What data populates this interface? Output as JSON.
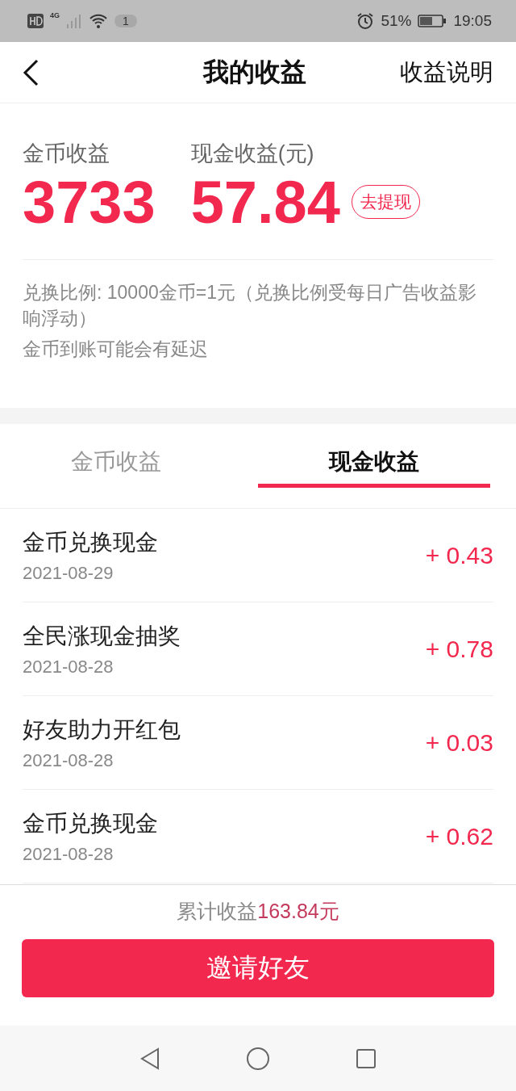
{
  "status_bar": {
    "network": "4G",
    "notification_count": "1",
    "battery": "51%",
    "time": "19:05"
  },
  "header": {
    "title": "我的收益",
    "action": "收益说明"
  },
  "summary": {
    "coin_label": "金币收益",
    "coin_value": "3733",
    "cash_label": "现金收益(元)",
    "cash_value": "57.84",
    "withdraw": "去提现",
    "notes": [
      "兑换比例: 10000金币=1元（兑换比例受每日广告收益影响浮动）",
      "金币到账可能会有延迟"
    ]
  },
  "tabs": [
    {
      "label": "金币收益",
      "selected": false
    },
    {
      "label": "现金收益",
      "selected": true
    }
  ],
  "records": [
    {
      "title": "金币兑换现金",
      "date": "2021-08-29",
      "amount": "+ 0.43"
    },
    {
      "title": "全民涨现金抽奖",
      "date": "2021-08-28",
      "amount": "+ 0.78"
    },
    {
      "title": "好友助力开红包",
      "date": "2021-08-28",
      "amount": "+ 0.03"
    },
    {
      "title": "金币兑换现金",
      "date": "2021-08-28",
      "amount": "+ 0.62"
    }
  ],
  "footer": {
    "total_label": "累计收益",
    "total_value": "163.84元",
    "invite": "邀请好友"
  }
}
